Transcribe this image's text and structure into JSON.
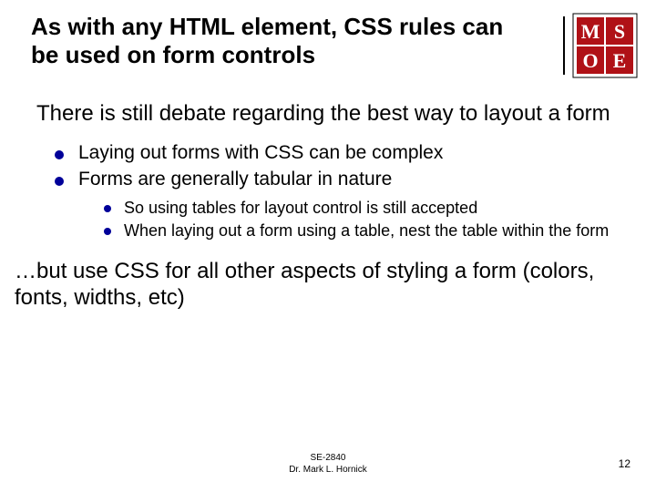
{
  "title": "As with any HTML element, CSS rules can be used on form controls",
  "logo": {
    "line1": "MS",
    "line2": "OE",
    "bg": "#b01116",
    "fg": "#ffffff"
  },
  "body": {
    "lead": "There is still debate regarding the best way to layout a form",
    "level1": [
      "Laying out forms with CSS can be complex",
      "Forms are generally tabular in nature"
    ],
    "level2": [
      "So using tables for layout control is still accepted",
      "When laying out a form using a table, nest the table within the form"
    ],
    "closing": "…but use CSS for all other aspects of styling a form (colors, fonts, widths, etc)"
  },
  "footer": {
    "course": "SE-2840",
    "author": "Dr. Mark L. Hornick",
    "page": "12"
  }
}
